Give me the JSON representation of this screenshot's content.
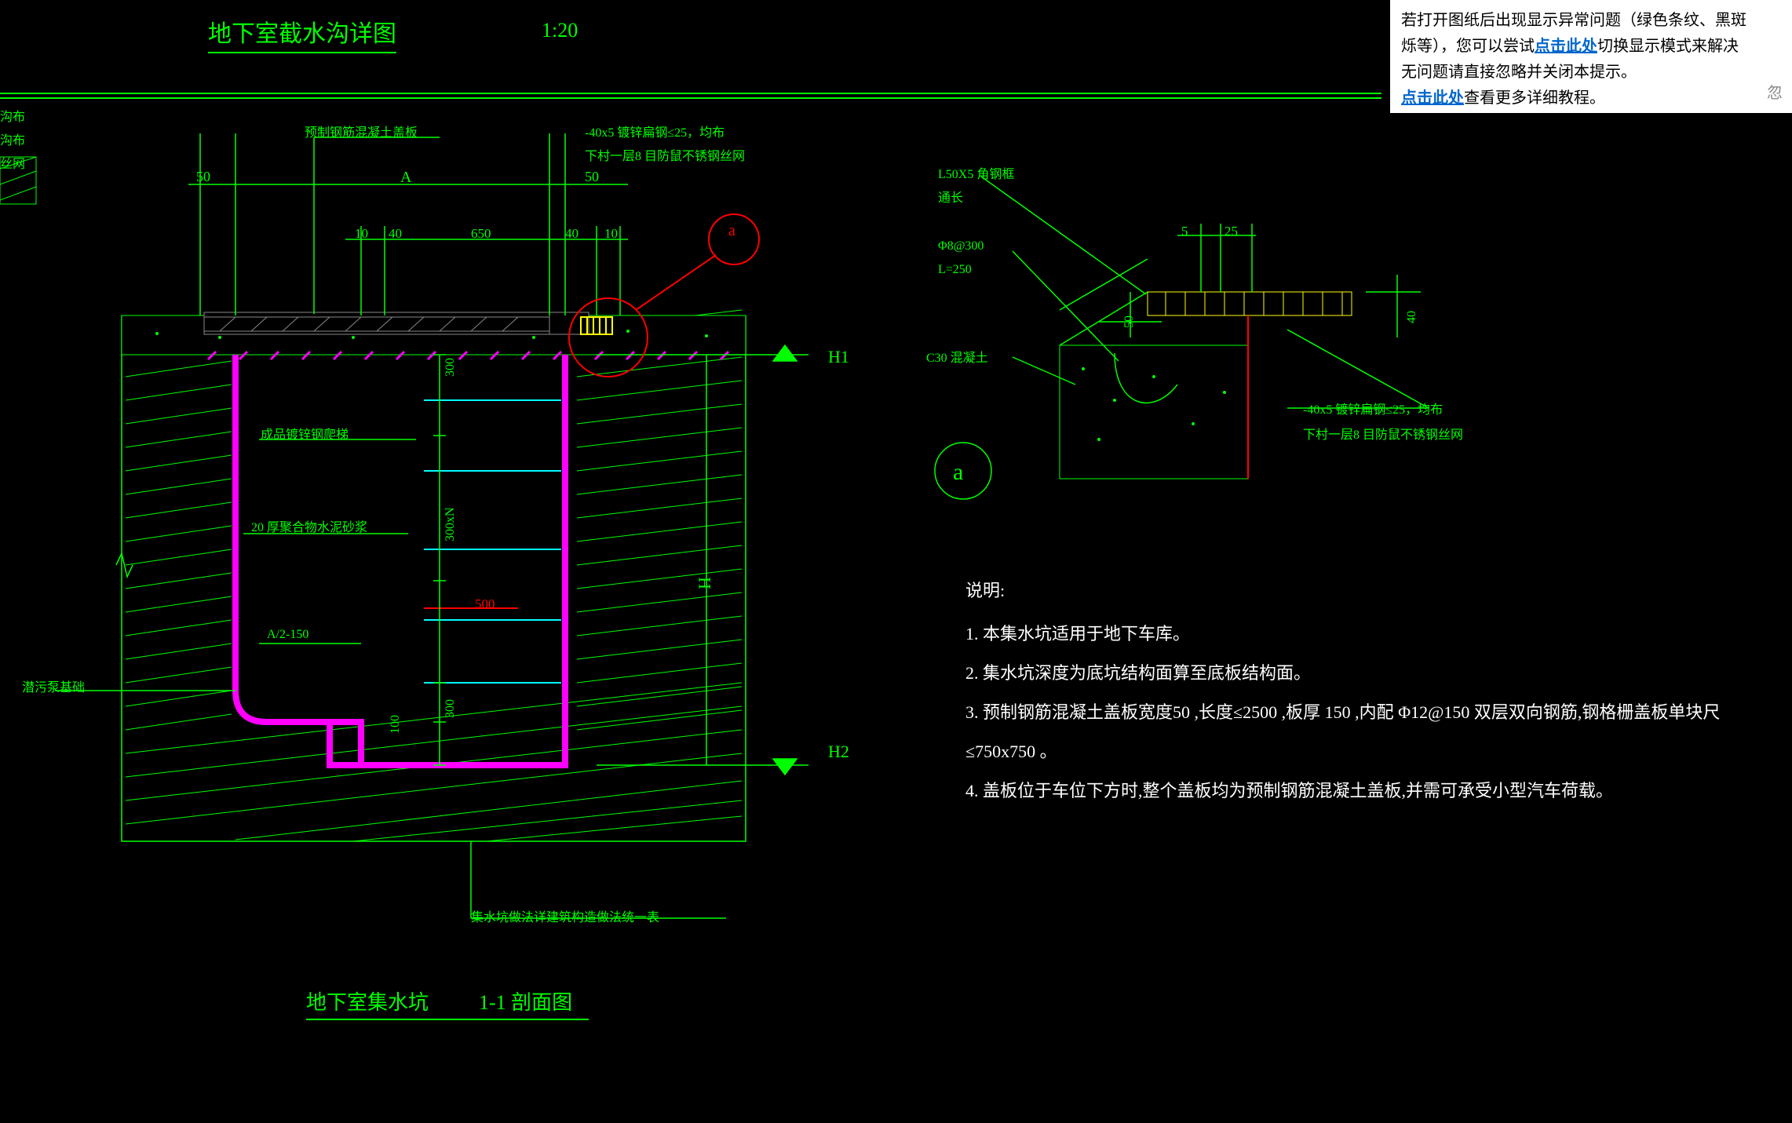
{
  "header": {
    "main_title": "地下室截水沟详图",
    "scale": "1:20"
  },
  "notification": {
    "line1_prefix": "若打开图纸后出现显示异常问题（绿色条纹、黑斑",
    "line1_suffix": "烁等），您可以尝试",
    "link1": "点击此处",
    "line1_tail": "切换显示模式来解决",
    "line2": "无问题请直接忽略并关闭本提示。",
    "link2": "点击此处",
    "link2_tail": "查看更多详细教程。",
    "close_btn": "忽"
  },
  "left_cut": {
    "l1": "沟布",
    "l2": "沟布",
    "l3": "丝网"
  },
  "main_view": {
    "top_label1": "预制钢筋混凝土盖板",
    "top_label2_a": "-40x5   镀锌扁钢≤25，均布",
    "top_label2_b": "下村一层8 目防鼠不锈钢丝网",
    "dim_50_l": "50",
    "dim_A": "A",
    "dim_50_r": "50",
    "dim_10_l": "10",
    "dim_40": "40",
    "dim_650": "650",
    "dim_40_r": "40",
    "dim_10_r": "10",
    "callout_a": "a",
    "H1": "H1",
    "H2": "H2",
    "H": "H",
    "dim_v_300_t": "300",
    "dim_v_300xN": "300xN",
    "dim_v_300_b": "300",
    "dim_v_100": "100",
    "ladder_label": "成品镀锌钢爬梯",
    "mortar_label": "20 厚聚合物水泥砂浆",
    "dim_500": "500",
    "a2_150": "A/2-150",
    "pump_base": "潜污泵基础",
    "bottom_note": "集水坑做法详建筑构造做法统一表",
    "title": "地下室集水坑",
    "section": "1-1 剖面图"
  },
  "detail_a": {
    "l50": "L50X5   角钢框",
    "l50_b": "通长",
    "phi8": "Φ8@300",
    "l250": "L=250",
    "c30": "C30 混凝土",
    "d5": "5",
    "d25": "25",
    "d50": "50",
    "d40": "40",
    "anno_a": "-40x5   镀锌扁钢≤25，均布",
    "anno_b": "下村一层8 目防鼠不锈钢丝网",
    "mark": "a"
  },
  "notes": {
    "title": "说明:",
    "n1": "1. 本集水坑适用于地下车库。",
    "n2": "2. 集水坑深度为底坑结构面算至底板结构面。",
    "n3": "3. 预制钢筋混凝土盖板宽度50   ,长度≤2500   ,板厚 150    ,内配 Φ12@150    双层双向钢筋,钢格栅盖板单块尺",
    "n3b": "≤750x750    。",
    "n4": "4. 盖板位于车位下方时,整个盖板均为预制钢筋混凝土盖板,并需可承受小型汽车荷载。"
  }
}
